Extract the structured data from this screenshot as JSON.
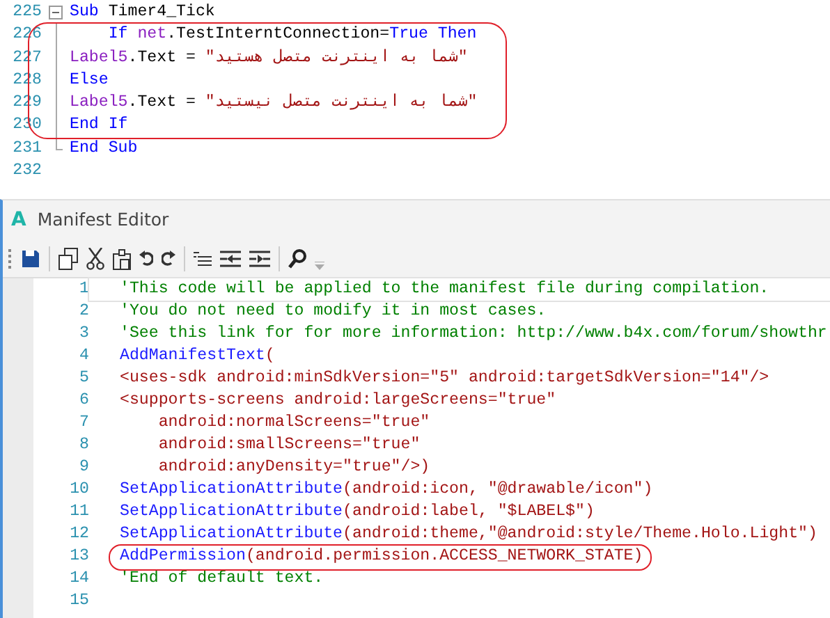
{
  "code_editor": {
    "lines": [
      {
        "number": "225",
        "kind": "fold_start",
        "circled": false,
        "tokens": [
          {
            "kind": "keyword",
            "text": "Sub"
          },
          {
            "kind": "plain",
            "text": " Timer4_Tick"
          }
        ]
      },
      {
        "number": "226",
        "kind": "fold_body",
        "circled": true,
        "tokens": [
          {
            "kind": "keyword",
            "text": "    If "
          },
          {
            "kind": "ident",
            "text": "net"
          },
          {
            "kind": "plain",
            "text": ".TestInterntConnection="
          },
          {
            "kind": "keyword",
            "text": "True Then"
          }
        ]
      },
      {
        "number": "227",
        "kind": "fold_body",
        "circled": true,
        "tokens": [
          {
            "kind": "ident",
            "text": "Label5"
          },
          {
            "kind": "plain",
            "text": ".Text = "
          },
          {
            "kind": "string",
            "text": "\"شما به اینترنت متصل هستید\""
          }
        ]
      },
      {
        "number": "228",
        "kind": "fold_body",
        "circled": true,
        "tokens": [
          {
            "kind": "keyword",
            "text": "Else"
          }
        ]
      },
      {
        "number": "229",
        "kind": "fold_body",
        "circled": true,
        "tokens": [
          {
            "kind": "ident",
            "text": "Label5"
          },
          {
            "kind": "plain",
            "text": ".Text = "
          },
          {
            "kind": "string",
            "text": "\"شما به اینترنت متصل نیستید\""
          }
        ]
      },
      {
        "number": "230",
        "kind": "fold_body",
        "circled": true,
        "tokens": [
          {
            "kind": "keyword",
            "text": "End If"
          }
        ]
      },
      {
        "number": "231",
        "kind": "fold_end",
        "circled": false,
        "tokens": [
          {
            "kind": "keyword",
            "text": "End Sub"
          }
        ]
      },
      {
        "number": "232",
        "kind": "plain",
        "circled": false
      }
    ]
  },
  "manifest_window": {
    "app_icon": "A",
    "title": "Manifest Editor",
    "lines": [
      {
        "number": "1",
        "current": true,
        "circled": false,
        "tokens": [
          {
            "kind": "comment",
            "text": "'This code will be applied to the manifest file during compilation."
          }
        ]
      },
      {
        "number": "2",
        "current": false,
        "circled": false,
        "tokens": [
          {
            "kind": "comment",
            "text": "'You do not need to modify it in most cases."
          }
        ]
      },
      {
        "number": "3",
        "current": false,
        "circled": false,
        "tokens": [
          {
            "kind": "comment",
            "text": "'See this link for for more information: http://www.b4x.com/forum/showthr"
          }
        ]
      },
      {
        "number": "4",
        "current": false,
        "circled": false,
        "tokens": [
          {
            "kind": "function",
            "text": "AddManifestText"
          },
          {
            "kind": "string",
            "text": "("
          }
        ]
      },
      {
        "number": "5",
        "current": false,
        "circled": false,
        "tokens": [
          {
            "kind": "string",
            "text": "<uses-sdk android:minSdkVersion=\"5\" android:targetSdkVersion=\"14\"/>"
          }
        ]
      },
      {
        "number": "6",
        "current": false,
        "circled": false,
        "tokens": [
          {
            "kind": "string",
            "text": "<supports-screens android:largeScreens=\"true\""
          }
        ]
      },
      {
        "number": "7",
        "current": false,
        "circled": false,
        "tokens": [
          {
            "kind": "string",
            "text": "    android:normalScreens=\"true\""
          }
        ]
      },
      {
        "number": "8",
        "current": false,
        "circled": false,
        "tokens": [
          {
            "kind": "string",
            "text": "    android:smallScreens=\"true\""
          }
        ]
      },
      {
        "number": "9",
        "current": false,
        "circled": false,
        "tokens": [
          {
            "kind": "string",
            "text": "    android:anyDensity=\"true\"/>)"
          }
        ]
      },
      {
        "number": "10",
        "current": false,
        "circled": false,
        "tokens": [
          {
            "kind": "function",
            "text": "SetApplicationAttribute"
          },
          {
            "kind": "string",
            "text": "(android:icon, \"@drawable/icon\")"
          }
        ]
      },
      {
        "number": "11",
        "current": false,
        "circled": false,
        "tokens": [
          {
            "kind": "function",
            "text": "SetApplicationAttribute"
          },
          {
            "kind": "string",
            "text": "(android:label, \"$LABEL$\")"
          }
        ]
      },
      {
        "number": "12",
        "current": false,
        "circled": false,
        "tokens": [
          {
            "kind": "function",
            "text": "SetApplicationAttribute"
          },
          {
            "kind": "string",
            "text": "(android:theme,\"@android:style/Theme.Holo.Light\")"
          }
        ]
      },
      {
        "number": "13",
        "current": false,
        "circled": true,
        "tokens": [
          {
            "kind": "function",
            "text": "AddPermission"
          },
          {
            "kind": "string",
            "text": "(android.permission.ACCESS_NETWORK_STATE)"
          }
        ]
      },
      {
        "number": "14",
        "current": false,
        "circled": false,
        "tokens": [
          {
            "kind": "comment",
            "text": "'End of default text."
          }
        ]
      },
      {
        "number": "15",
        "current": false,
        "circled": false
      }
    ]
  }
}
